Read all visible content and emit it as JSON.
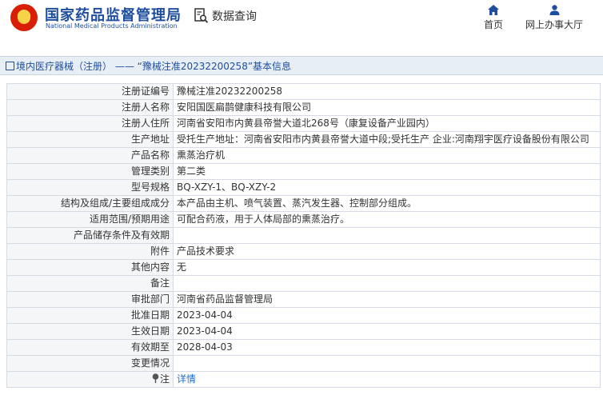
{
  "header": {
    "site_name_cn": "国家药品监督管理局",
    "site_name_en": "National Medical Products Administration",
    "query_label": "数据查询",
    "nav": [
      {
        "label": "首页",
        "icon": "home-icon"
      },
      {
        "label": "网上办事大厅",
        "icon": "user-icon"
      }
    ]
  },
  "breadcrumb": {
    "text": "境内医疗器械（注册） —— “豫械注准20232200258”基本信息"
  },
  "rows": [
    {
      "key": "注册证编号",
      "value": "豫械注准20232200258"
    },
    {
      "key": "注册人名称",
      "value": "安阳国医扁鹊健康科技有限公司"
    },
    {
      "key": "注册人住所",
      "value": "河南省安阳市内黄县帝誉大道北268号（康复设备产业园内）"
    },
    {
      "key": "生产地址",
      "value": "受托生产地址：河南省安阳市内黄县帝誉大道中段;受托生产 企业:河南翔宇医疗设备股份有限公司"
    },
    {
      "key": "产品名称",
      "value": "熏蒸治疗机"
    },
    {
      "key": "管理类别",
      "value": "第二类"
    },
    {
      "key": "型号规格",
      "value": "BQ-XZY-1、BQ-XZY-2"
    },
    {
      "key": "结构及组成/主要组成成分",
      "value": "本产品由主机、喷气装置、蒸汽发生器、控制部分组成。"
    },
    {
      "key": "适用范围/预期用途",
      "value": "可配合药液，用于人体局部的熏蒸治疗。"
    },
    {
      "key": "产品储存条件及有效期",
      "value": ""
    },
    {
      "key": "附件",
      "value": "产品技术要求"
    },
    {
      "key": "其他内容",
      "value": "无"
    },
    {
      "key": "备注",
      "value": ""
    },
    {
      "key": "审批部门",
      "value": "河南省药品监督管理局"
    },
    {
      "key": "批准日期",
      "value": "2023-04-04"
    },
    {
      "key": "生效日期",
      "value": "2023-04-04"
    },
    {
      "key": "有效期至",
      "value": "2028-04-03"
    },
    {
      "key": "变更情况",
      "value": ""
    }
  ],
  "note_row": {
    "key": "注",
    "value": "详情",
    "icon": "pin-icon"
  }
}
